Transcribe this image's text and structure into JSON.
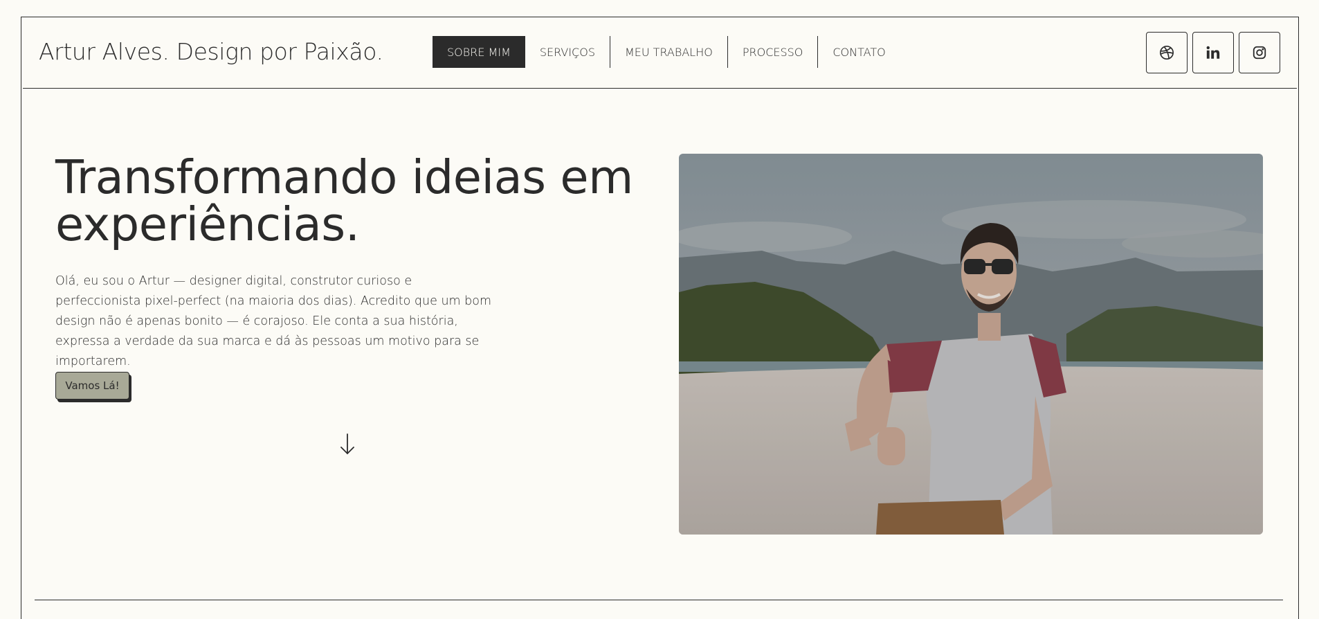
{
  "brand": {
    "name": "Artur Alves. Design por Paixão."
  },
  "nav": {
    "items": [
      {
        "label": "SOBRE MIM",
        "active": true
      },
      {
        "label": "SERVIÇOS",
        "active": false
      },
      {
        "label": "MEU TRABALHO",
        "active": false
      },
      {
        "label": "PROCESSO",
        "active": false
      },
      {
        "label": "CONTATO",
        "active": false
      }
    ]
  },
  "socials": [
    {
      "icon": "dribbble-icon"
    },
    {
      "icon": "linkedin-icon"
    },
    {
      "icon": "instagram-icon"
    }
  ],
  "hero": {
    "title_line1": "Transformando ideias em",
    "title_line2": "experiências.",
    "text": "Olá, eu sou o Artur — designer digital, construtor curioso e perfeccionista pixel-perfect (na maioria dos dias). Acredito que um bom design não é apenas bonito — é corajoso. Ele conta a sua história, expressa a verdade da sua marca e dá às pessoas um motivo para se importarem.",
    "cta_label": "Vamos Lá!",
    "scroll_icon": "arrow-down-icon",
    "photo_icon": "portrait-photo"
  },
  "colors": {
    "background": "#fcfbf6",
    "ink": "#2b2b2b",
    "cta": "#a8a997"
  }
}
